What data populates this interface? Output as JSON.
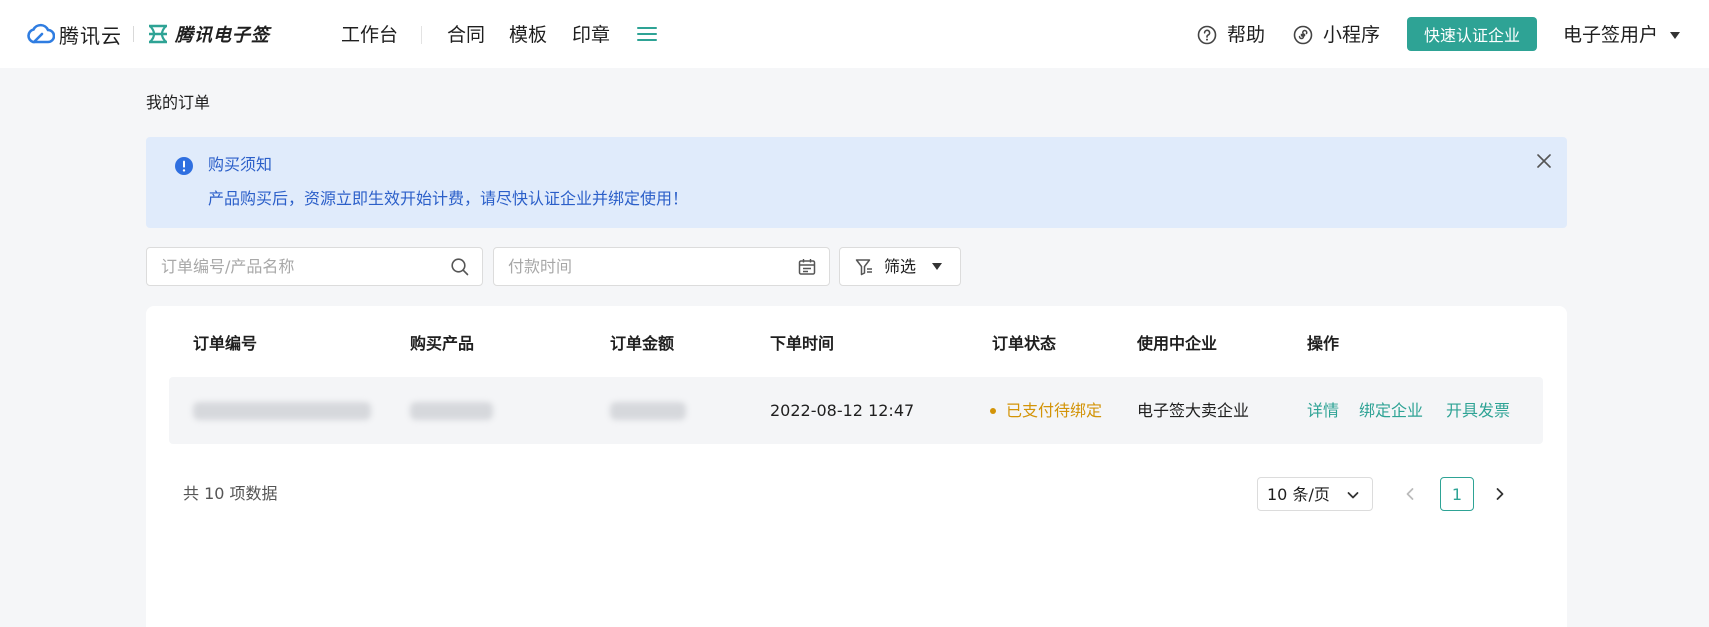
{
  "brand": {
    "cloud_name": "腾讯云",
    "esign_name": "腾讯电子签"
  },
  "nav": {
    "items": [
      "工作台",
      "合同",
      "模板",
      "印章"
    ]
  },
  "header": {
    "help_label": "帮助",
    "miniprogram_label": "小程序",
    "cta_label": "快速认证企业",
    "user_label": "电子签用户"
  },
  "page": {
    "title": "我的订单"
  },
  "notice": {
    "title": "购买须知",
    "body": "产品购买后，资源立即生效开始计费，请尽快认证企业并绑定使用！"
  },
  "filters": {
    "search_placeholder": "订单编号/产品名称",
    "date_placeholder": "付款时间",
    "filter_label": "筛选"
  },
  "table": {
    "columns": [
      "订单编号",
      "购买产品",
      "订单金额",
      "下单时间",
      "订单状态",
      "使用中企业",
      "操作"
    ],
    "rows": [
      {
        "order_time": "2022-08-12 12:47",
        "status": "已支付待绑定",
        "enterprise": "电子签大卖企业",
        "actions": [
          "详情",
          "绑定企业",
          "开具发票"
        ]
      }
    ]
  },
  "pagination": {
    "total_text": "共 10 项数据",
    "page_size": "10 条/页",
    "current_page": "1"
  },
  "colors": {
    "accent": "#2ea395",
    "notice_bg": "#e0ebfb",
    "notice_text": "#2b5fc9",
    "status_pending": "#d39408"
  }
}
